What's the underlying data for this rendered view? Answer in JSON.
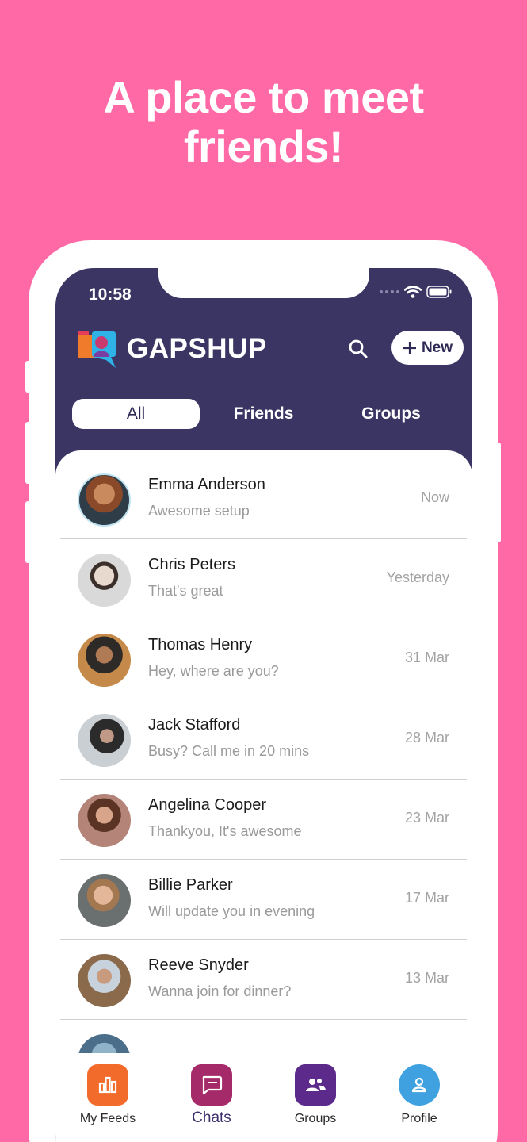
{
  "headline": {
    "line1": "A place to meet",
    "line2": "friends!"
  },
  "status_bar": {
    "time": "10:58"
  },
  "header": {
    "logo_text": "GAPSHUP",
    "new_button_label": "New"
  },
  "tabs": [
    {
      "label": "All",
      "active": true
    },
    {
      "label": "Friends",
      "active": false
    },
    {
      "label": "Groups",
      "active": false
    }
  ],
  "chats": [
    {
      "name": "Emma Anderson",
      "message": "Awesome setup",
      "time": "Now"
    },
    {
      "name": "Chris Peters",
      "message": "That's great",
      "time": "Yesterday"
    },
    {
      "name": "Thomas Henry",
      "message": "Hey, where are you?",
      "time": "31 Mar"
    },
    {
      "name": "Jack Stafford",
      "message": "Busy? Call me in 20 mins",
      "time": "28 Mar"
    },
    {
      "name": "Angelina Cooper",
      "message": "Thankyou, It's awesome",
      "time": "23 Mar"
    },
    {
      "name": "Billie Parker",
      "message": "Will update you in evening",
      "time": "17 Mar"
    },
    {
      "name": "Reeve Snyder",
      "message": "Wanna join for dinner?",
      "time": "13 Mar"
    }
  ],
  "bottom_nav": [
    {
      "label": "My Feeds",
      "icon": "bar-chart-icon",
      "color": "#f26b2a"
    },
    {
      "label": "Chats",
      "icon": "chat-bubble-icon",
      "color": "#a52a6a"
    },
    {
      "label": "Groups",
      "icon": "group-icon",
      "color": "#5c2a8a"
    },
    {
      "label": "Profile",
      "icon": "profile-icon",
      "color": "#3fa1e0"
    }
  ],
  "colors": {
    "background": "#ff69a6",
    "header": "#3b3563",
    "accent_text": "#2f2a55"
  }
}
